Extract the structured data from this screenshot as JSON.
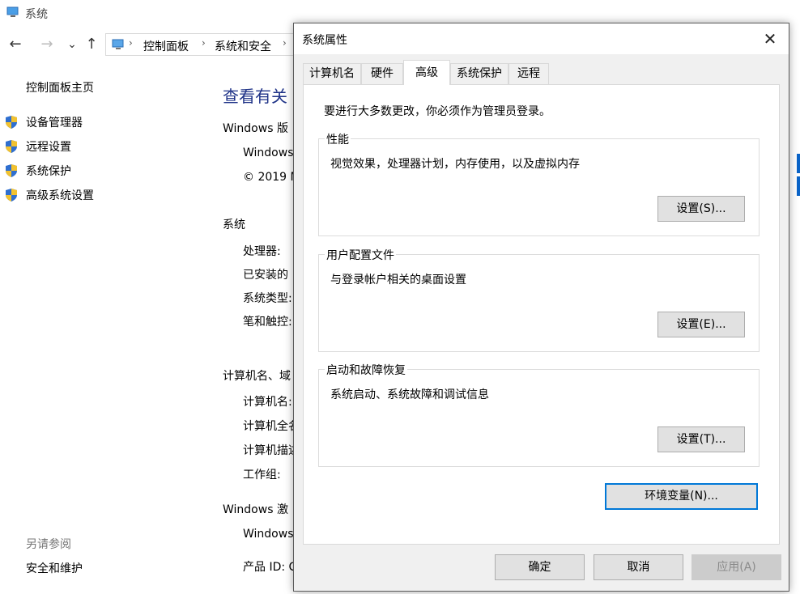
{
  "background_window": {
    "title": "系统",
    "nav": {
      "back_icon": "←",
      "forward_icon": "→",
      "recent_icon": "⌄",
      "up_icon": "↑"
    },
    "breadcrumbs": [
      "控制面板",
      "系统和安全"
    ],
    "sidebar": {
      "home": "控制面板主页",
      "items": [
        {
          "label": "设备管理器",
          "icon": "shield-icon"
        },
        {
          "label": "远程设置",
          "icon": "shield-icon"
        },
        {
          "label": "系统保护",
          "icon": "shield-icon"
        },
        {
          "label": "高级系统设置",
          "icon": "shield-icon"
        }
      ],
      "see_also": "另请参阅",
      "security_link": "安全和维护"
    },
    "content": {
      "title": "查看有关",
      "windows_edition_header": "Windows 版",
      "windows_name": "Windows",
      "copyright": "© 2019 M",
      "system_header": "系统",
      "processor": "处理器:",
      "installed": "已安装的",
      "system_type": "系统类型:",
      "pen_touch": "笔和触控:",
      "computer_name_header": "计算机名、域",
      "computer_name": "计算机名:",
      "full_name": "计算机全名",
      "description": "计算机描述",
      "workgroup": "工作组:",
      "activation_header": "Windows 激",
      "activation_windows": "Windows",
      "product_id": "产品 ID: C"
    }
  },
  "dialog": {
    "title": "系统属性",
    "close_glyph": "✕",
    "tabs": [
      {
        "label": "计算机名",
        "active": false
      },
      {
        "label": "硬件",
        "active": false
      },
      {
        "label": "高级",
        "active": true
      },
      {
        "label": "系统保护",
        "active": false
      },
      {
        "label": "远程",
        "active": false
      }
    ],
    "admin_note": "要进行大多数更改，你必须作为管理员登录。",
    "groups": [
      {
        "title": "性能",
        "description": "视觉效果，处理器计划，内存使用，以及虚拟内存",
        "button": "设置(S)..."
      },
      {
        "title": "用户配置文件",
        "description": "与登录帐户相关的桌面设置",
        "button": "设置(E)..."
      },
      {
        "title": "启动和故障恢复",
        "description": "系统启动、系统故障和调试信息",
        "button": "设置(T)..."
      }
    ],
    "env_button": "环境变量(N)...",
    "footer": {
      "ok": "确定",
      "cancel": "取消",
      "apply": "应用(A)"
    },
    "colors": {
      "focus_border": "#0078d7",
      "title_link": "#1e3287"
    }
  }
}
